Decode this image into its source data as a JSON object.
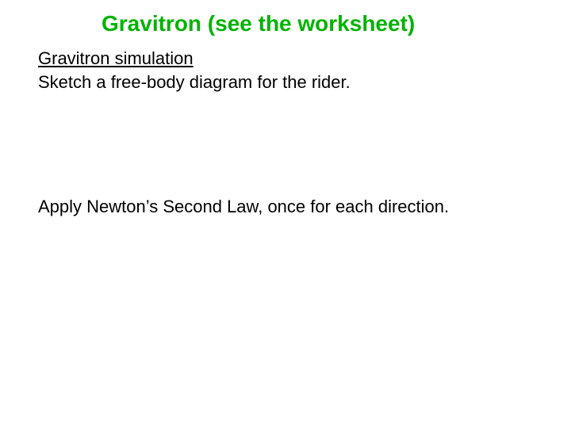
{
  "title": "Gravitron (see the worksheet)",
  "link_text": "Gravitron simulation",
  "instruction_1": "Sketch a free-body diagram for the rider.",
  "instruction_2": "Apply Newton’s Second Law, once for each direction."
}
